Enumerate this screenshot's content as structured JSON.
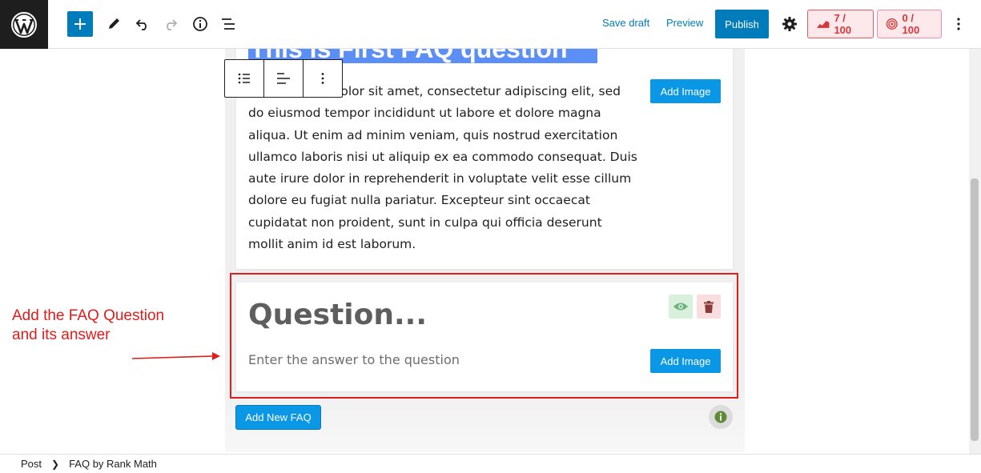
{
  "toolbar": {
    "save_draft": "Save draft",
    "preview": "Preview",
    "publish": "Publish",
    "seo_score": "7 / 100",
    "content_score": "0 / 100"
  },
  "faq": {
    "heading_visible": "This is First FAQ question",
    "answer_text": "Lorem ipsum dolor sit amet, consectetur adipiscing elit, sed do eiusmod tempor incididunt ut labore et dolore magna aliqua. Ut enim ad minim veniam, quis nostrud exercitation ullamco laboris nisi ut aliquip ex ea commodo consequat. Duis aute irure dolor in reprehenderit in voluptate velit esse cillum dolore eu fugiat nulla pariatur. Excepteur sint occaecat cupidatat non proident, sunt in culpa qui officia deserunt mollit anim id est laborum.",
    "add_image": "Add Image",
    "question_placeholder": "Question...",
    "answer_placeholder": "Enter the answer to the question",
    "add_new_faq": "Add New FAQ"
  },
  "annotation": {
    "line1": "Add the FAQ Question",
    "line2": "and its answer",
    "color": "#e21b1b"
  },
  "breadcrumb": [
    "Post",
    "FAQ by Rank Math"
  ],
  "colors": {
    "accent": "#007cba",
    "button_blue": "#0a97e6",
    "selection": "#5b8ff5",
    "score_red": "#d63638"
  }
}
